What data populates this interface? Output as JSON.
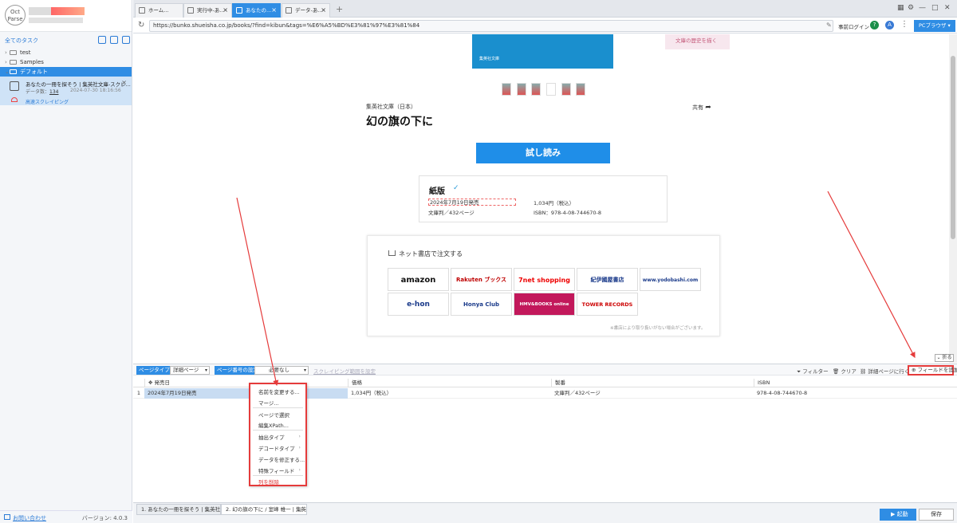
{
  "sidebar": {
    "all_tasks": "全てのタスク",
    "tree": [
      {
        "label": "test"
      },
      {
        "label": "Samples"
      },
      {
        "label": "デフォルト"
      }
    ],
    "task": {
      "title": "あなたの一冊を探そう | 集英社文庫-スクレ...",
      "count_label": "データ数：",
      "count_value": "134",
      "time": "2024-07-30 18:16:56",
      "mode": "高速スクレイピング"
    },
    "contact": "お問い合わせ",
    "version": "バージョン: 4.0.3"
  },
  "browser": {
    "tabs": [
      {
        "label": "ホーム..."
      },
      {
        "label": "実行中-あ..."
      },
      {
        "label": "あなたの..."
      },
      {
        "label": "データ-あ..."
      }
    ],
    "new_tab": "+",
    "url": "https://bunko.shueisha.co.jp/books/?find=kibun&tags=%E6%A5%BD%E3%81%97%E3%81%84",
    "prelogin": "事前ログイン",
    "pc_browser": "PCブラウザ"
  },
  "page": {
    "hero_label": "集英社文庫",
    "ad_text": "文庫の歴史を描く",
    "publisher": "集英社文庫（日本）",
    "share": "共有",
    "title": "幻の旗の下に",
    "trial": "試し読み",
    "paper": {
      "title": "紙版",
      "date": "2024年7月19日発売",
      "format": "文庫判／432ページ",
      "price": "1,034円（税込）",
      "isbn": "ISBN：978-4-08-744670-8"
    },
    "stores_heading": "ネット書店で注文する",
    "stores": [
      "amazon",
      "Rakuten ブックス",
      "7net shopping",
      "紀伊國屋書店",
      "www.yodobashi.com",
      "e-hon",
      "Honya Club",
      "HMV&BOOKS online",
      "TOWER RECORDS"
    ],
    "stores_note": "※書店により取り扱いがない場合がございます。",
    "fold": "折る"
  },
  "panel": {
    "page_type_label": "ページタイプ",
    "page_type_value": "詳細ページ",
    "page_num_label": "ページ番号の設定",
    "page_num_value": "必要なし",
    "scrape_range": "スクレイピング範囲を設定",
    "filter": "フィルター",
    "clear": "クリア",
    "goto_detail": "詳細ページに行く",
    "add_field": "フィールドを追加"
  },
  "grid": {
    "columns": [
      "発売日",
      "価格",
      "製番",
      "ISBN"
    ],
    "rows": [
      {
        "num": "1",
        "cells": [
          "2024年7月19日発売",
          "1,034円（税込）",
          "文庫判／432ページ",
          "978-4-08-744670-8"
        ]
      }
    ]
  },
  "context_menu": {
    "items": [
      "名前を変更する...",
      "マージ...",
      "ページで選択",
      "編集XPath...",
      "抽出タイプ",
      "デコードタイプ",
      "データを修正する...",
      "特殊フィールド",
      "列を削除"
    ]
  },
  "bottom": {
    "tabs": [
      {
        "label": "1. あなたの一冊を探そう | 集英社..."
      },
      {
        "label": "2. 幻の旗の下に / 室峰 帷一 | 集英..."
      }
    ],
    "start": "起動",
    "save": "保存"
  },
  "colors": {
    "accent": "#2f8de4",
    "highlight": "#e53b3b"
  }
}
